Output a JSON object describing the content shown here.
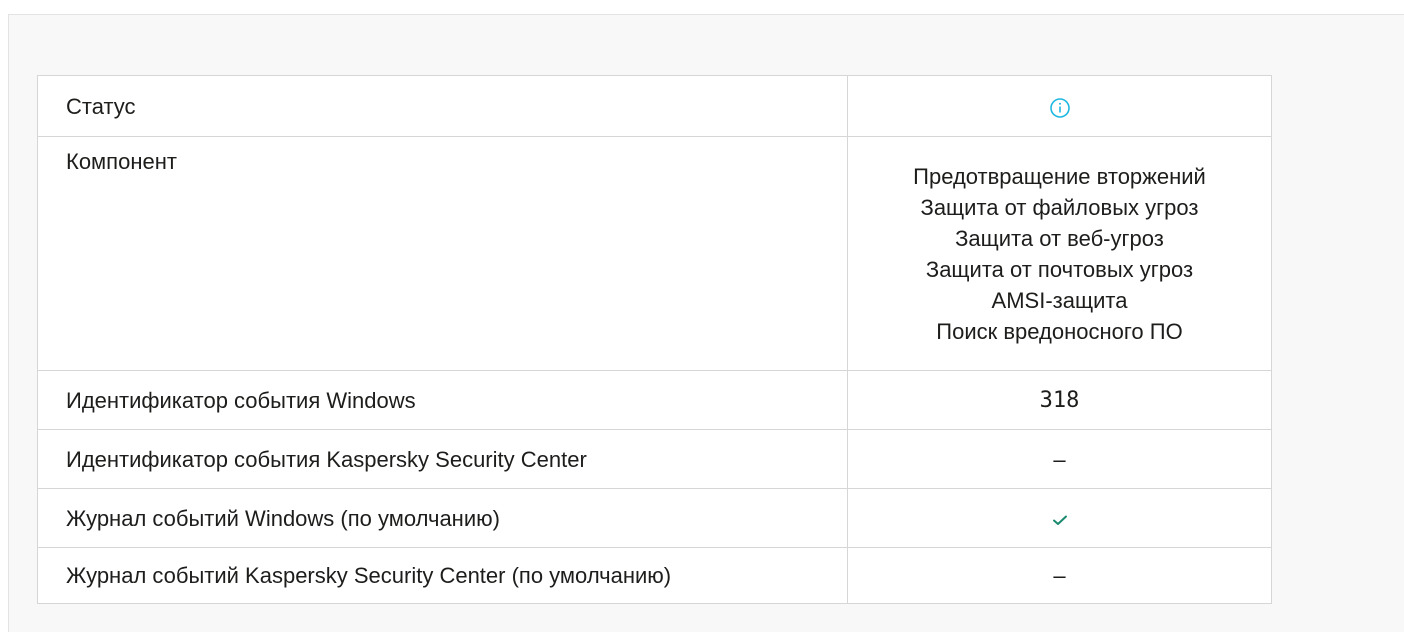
{
  "rows": {
    "status": {
      "label": "Статус",
      "icon": "info-icon",
      "icon_color": "#1eb8e0"
    },
    "component": {
      "label": "Компонент",
      "values": [
        "Предотвращение вторжений",
        "Защита от файловых угроз",
        "Защита от веб-угроз",
        "Защита от почтовых угроз",
        "AMSI-защита",
        "Поиск вредоносного ПО"
      ]
    },
    "windows_event_id": {
      "label": "Идентификатор события Windows",
      "value": "318"
    },
    "ksc_event_id": {
      "label": "Идентификатор события Kaspersky Security Center",
      "value": "–"
    },
    "windows_log": {
      "label": "Журнал событий Windows (по умолчанию)",
      "icon": "check-icon",
      "icon_color": "#1a8a6e"
    },
    "ksc_log": {
      "label": "Журнал событий Kaspersky Security Center (по умолчанию)",
      "value": "–"
    }
  }
}
